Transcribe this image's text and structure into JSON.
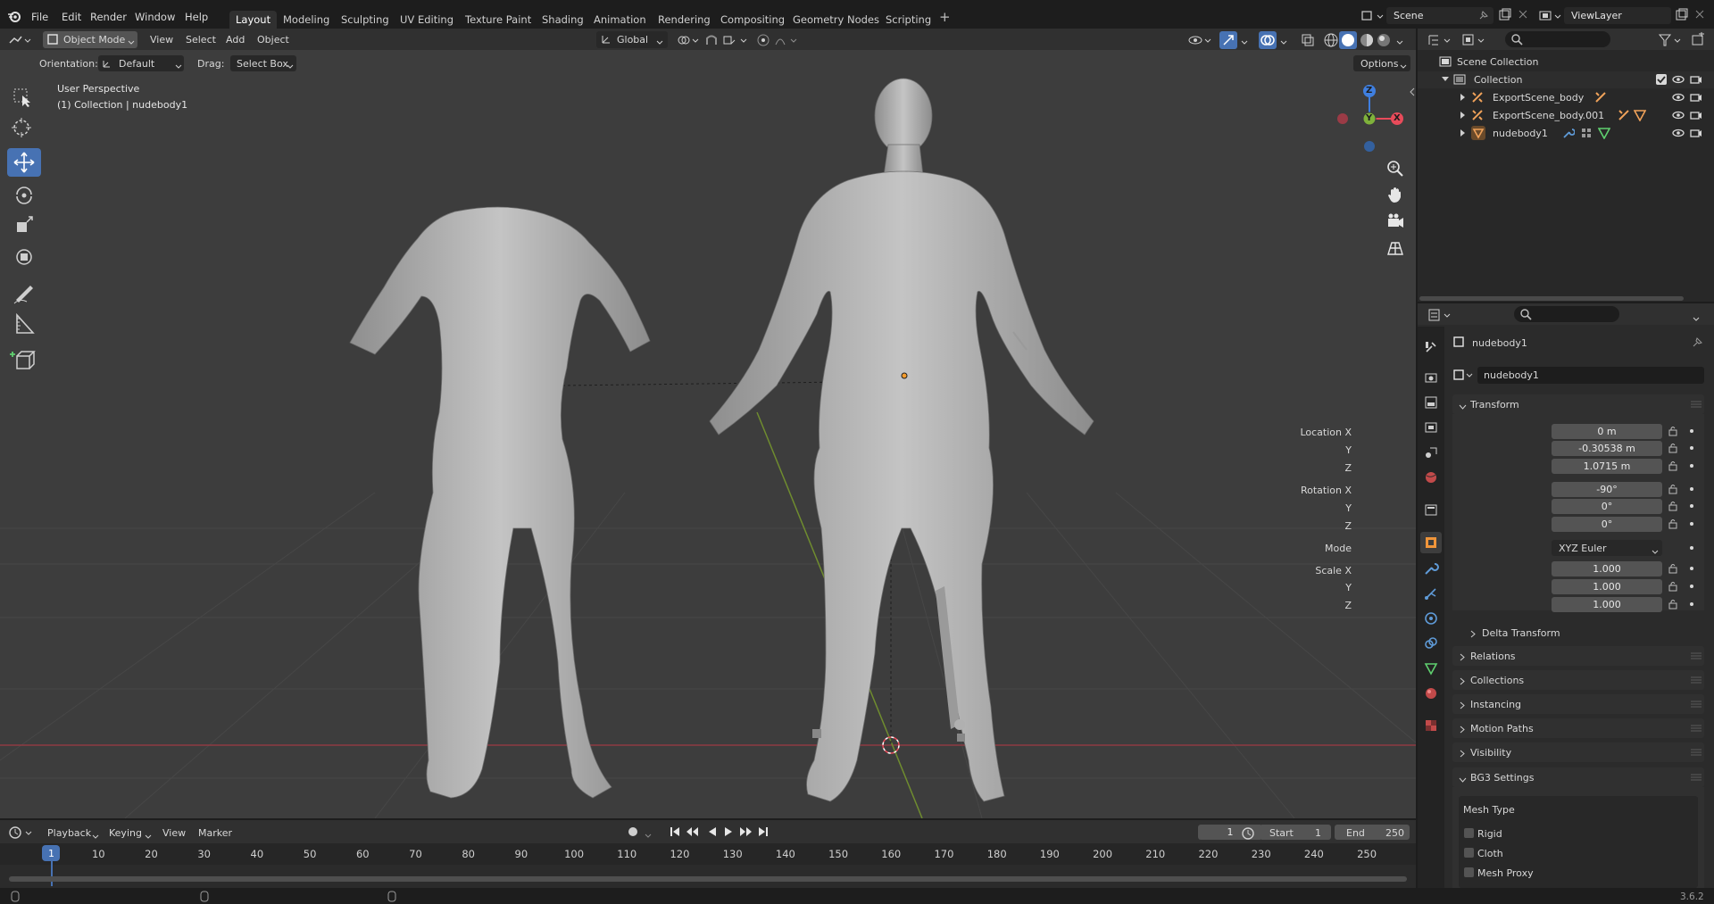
{
  "menu": {
    "items": [
      "File",
      "Edit",
      "Render",
      "Window",
      "Help"
    ]
  },
  "workspaces": {
    "tabs": [
      "Layout",
      "Modeling",
      "Sculpting",
      "UV Editing",
      "Texture Paint",
      "Shading",
      "Animation",
      "Rendering",
      "Compositing",
      "Geometry Nodes",
      "Scripting"
    ],
    "active": "Layout",
    "add_label": "+"
  },
  "scene": {
    "name": "Scene",
    "view_layer": "ViewLayer"
  },
  "viewport_header": {
    "mode": "Object Mode",
    "menus": [
      "View",
      "Select",
      "Add",
      "Object"
    ],
    "transform_space": "Global",
    "orientation_label": "Orientation:",
    "orientation_value": "Default",
    "drag_label": "Drag:",
    "drag_value": "Select Box",
    "options_label": "Options"
  },
  "viewport": {
    "perspective": "User Perspective",
    "collection_info": "(1) Collection | nudebody1",
    "gizmo_axes": {
      "x": "X",
      "y": "Y",
      "z": "Z"
    }
  },
  "outliner": {
    "root": "Scene Collection",
    "collection": "Collection",
    "items": [
      {
        "name": "ExportScene_body"
      },
      {
        "name": "ExportScene_body.001"
      },
      {
        "name": "nudebody1"
      }
    ]
  },
  "properties": {
    "object_name": "nudebody1",
    "data_name": "nudebody1",
    "transform_title": "Transform",
    "location_label": "Location X",
    "location": {
      "x": "0 m",
      "y": "-0.30538 m",
      "z": "1.0715 m"
    },
    "rotation_label": "Rotation X",
    "rotation": {
      "x": "-90°",
      "y": "0°",
      "z": "0°"
    },
    "mode_label": "Mode",
    "mode_value": "XYZ Euler",
    "scale_label": "Scale X",
    "scale": {
      "x": "1.000",
      "y": "1.000",
      "z": "1.000"
    },
    "axis_y": "Y",
    "axis_z": "Z",
    "delta_transform": "Delta Transform",
    "panels": [
      "Relations",
      "Collections",
      "Instancing",
      "Motion Paths",
      "Visibility"
    ],
    "bg3_title": "BG3 Settings",
    "mesh_type_label": "Mesh Type",
    "mesh_types": [
      "Rigid",
      "Cloth",
      "Mesh Proxy"
    ]
  },
  "timeline": {
    "menus": [
      "Playback",
      "Keying",
      "View",
      "Marker"
    ],
    "current_frame": "1",
    "start_label": "Start",
    "start_value": "1",
    "end_label": "End",
    "end_value": "250",
    "ruler": [
      "10",
      "20",
      "30",
      "40",
      "50",
      "60",
      "70",
      "80",
      "90",
      "100",
      "110",
      "120",
      "130",
      "140",
      "150",
      "160",
      "170",
      "180",
      "190",
      "200",
      "210",
      "220",
      "230",
      "240",
      "250"
    ],
    "playhead": "1"
  },
  "status": {
    "version": "3.6.2"
  },
  "colors": {
    "accent": "#4772b3",
    "x_axis": "#e84b5a",
    "y_axis": "#7fb23b",
    "z_axis": "#3f7fe0"
  }
}
